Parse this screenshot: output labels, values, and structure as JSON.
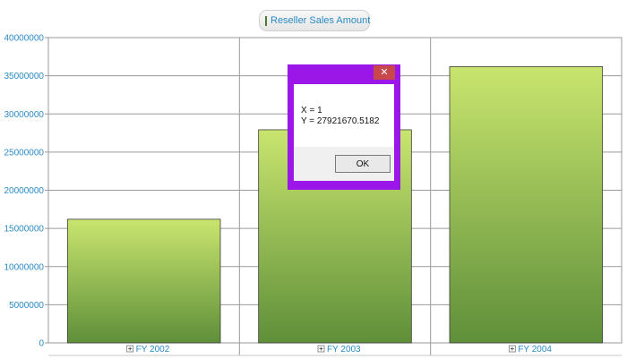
{
  "legend": {
    "label": "Reseller Sales Amount"
  },
  "colors": {
    "bar_top": "#c9e56e",
    "bar_bottom": "#5f8f3a",
    "bar_stroke": "#3b3b3b",
    "axis_text": "#2a8ac4",
    "dialog_border": "#9b17e8",
    "close_button": "#c8474b"
  },
  "chart_data": {
    "type": "bar",
    "categories": [
      "FY 2002",
      "FY 2003",
      "FY 2004"
    ],
    "series": [
      {
        "name": "Reseller Sales Amount",
        "values": [
          16200000,
          27921670.5182,
          36200000
        ]
      }
    ],
    "ylim": [
      0,
      40000000
    ],
    "yticks": [
      "0",
      "5000000",
      "10000000",
      "15000000",
      "20000000",
      "25000000",
      "30000000",
      "35000000",
      "40000000"
    ],
    "grid": true,
    "legend_position": "top-center"
  },
  "dialog": {
    "close_icon": "close-icon",
    "line1": "X = 1",
    "line2": "Y = 27921670.5182",
    "ok_label": "OK"
  }
}
